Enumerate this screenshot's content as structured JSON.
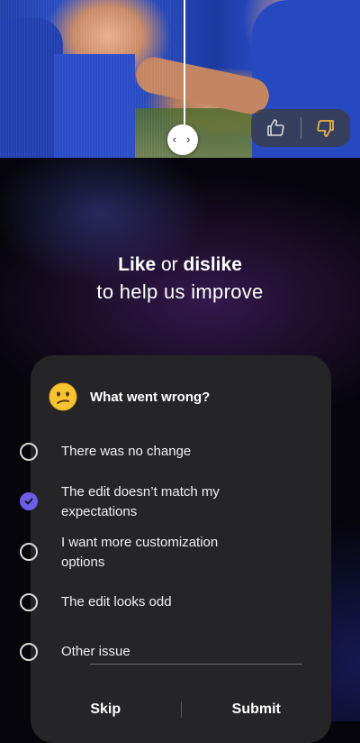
{
  "photo": {
    "compare_handle_glyph": "‹ ›",
    "like_icon": "thumbs-up-icon",
    "dislike_icon": "thumbs-down-icon",
    "dislike_color": "#e8b04a"
  },
  "headline": {
    "like_word": "Like",
    "or_word": " or ",
    "dislike_word": "dislike",
    "line2": "to help us improve"
  },
  "feedback": {
    "emoji_icon": "confused-face-icon",
    "title": "What went wrong?",
    "options": [
      {
        "label": "There was no change",
        "checked": false
      },
      {
        "label": "The edit doesn’t match my expectations",
        "checked": true
      },
      {
        "label": "I want more customization options",
        "checked": false
      },
      {
        "label": "The edit looks odd",
        "checked": false
      },
      {
        "label": "Other issue",
        "checked": false
      }
    ],
    "accent_color": "#6c5ce7"
  },
  "actions": {
    "skip_label": "Skip",
    "submit_label": "Submit"
  }
}
